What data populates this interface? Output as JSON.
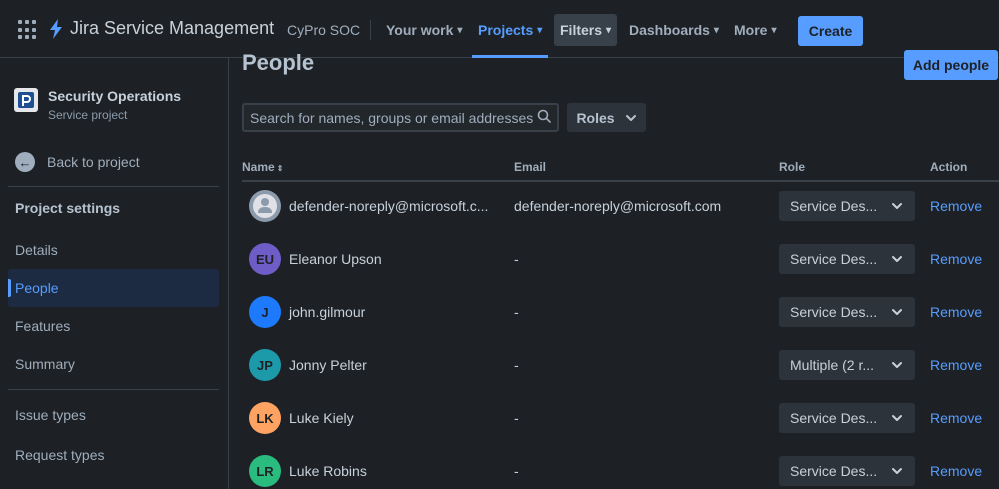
{
  "app": {
    "product_name": "Jira Service Management",
    "site_name": "CyPro SOC"
  },
  "nav": {
    "your_work": "Your work",
    "projects": "Projects",
    "filters": "Filters",
    "dashboards": "Dashboards",
    "more": "More",
    "create": "Create"
  },
  "sidebar": {
    "project_title": "Security Operations",
    "project_type": "Service project",
    "back": "Back to project",
    "heading": "Project settings",
    "items": [
      {
        "label": "Details"
      },
      {
        "label": "People",
        "active": true
      },
      {
        "label": "Features"
      },
      {
        "label": "Summary"
      },
      {
        "label": "Issue types"
      },
      {
        "label": "Request types"
      }
    ]
  },
  "main": {
    "title": "People",
    "add_people": "Add people",
    "search_placeholder": "Search for names, groups or email addresses",
    "roles_filter": "Roles",
    "columns": {
      "name": "Name",
      "email": "Email",
      "role": "Role",
      "action": "Action"
    },
    "rows": [
      {
        "initials": "",
        "avatar_color": "#8c9bab",
        "name": "defender-noreply@microsoft.c...",
        "email": "defender-noreply@microsoft.com",
        "role": "Service Des...",
        "action": "Remove"
      },
      {
        "initials": "EU",
        "avatar_color": "#6e5dc6",
        "name": "Eleanor Upson",
        "email": "-",
        "role": "Service Des...",
        "action": "Remove"
      },
      {
        "initials": "J",
        "avatar_color": "#1d7afc",
        "name": "john.gilmour",
        "email": "-",
        "role": "Service Des...",
        "action": "Remove"
      },
      {
        "initials": "JP",
        "avatar_color": "#1d9aaa",
        "name": "Jonny Pelter",
        "email": "-",
        "role": "Multiple (2 r...",
        "action": "Remove"
      },
      {
        "initials": "LK",
        "avatar_color": "#fea362",
        "name": "Luke Kiely",
        "email": "-",
        "role": "Service Des...",
        "action": "Remove"
      },
      {
        "initials": "LR",
        "avatar_color": "#2abb7f",
        "name": "Luke Robins",
        "email": "-",
        "role": "Service Des...",
        "action": "Remove"
      }
    ]
  },
  "colors": {
    "accent": "#579dff",
    "background": "#1d2125",
    "surface": "#2c333a"
  }
}
